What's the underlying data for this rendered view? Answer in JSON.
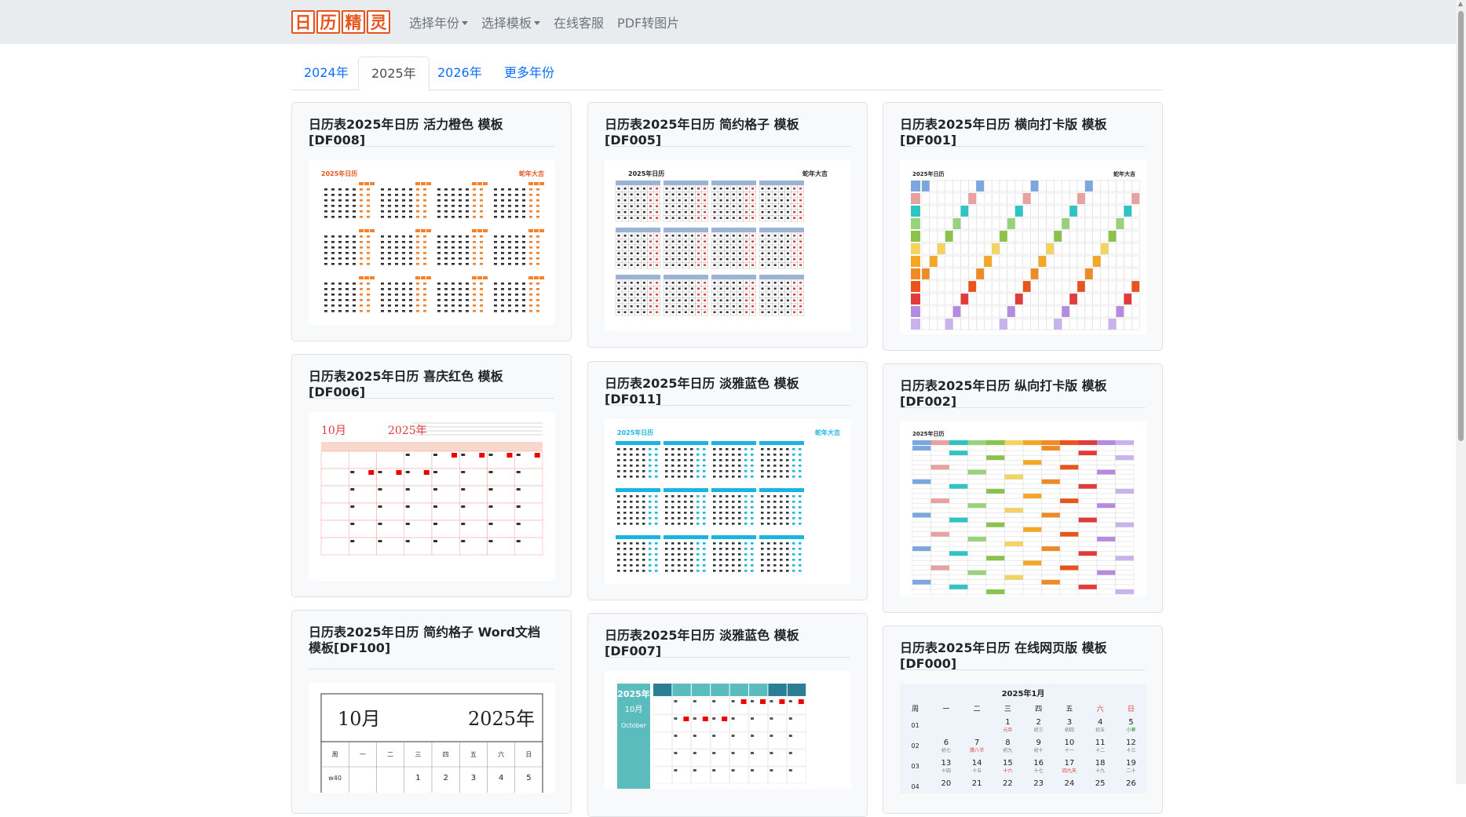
{
  "navbar": {
    "brand": [
      "日",
      "历",
      "精",
      "灵"
    ],
    "links": [
      "选择年份",
      "选择模板",
      "在线客服",
      "PDF转图片"
    ]
  },
  "tabs": [
    "2024年",
    "2025年",
    "2026年",
    "更多年份"
  ],
  "cards": [
    {
      "title": "日历表2025年日历 活力橙色 模板[DF008]",
      "heading": "2025年日历",
      "zodiac": "蛇年大吉"
    },
    {
      "title": "日历表2025年日历 简约格子 模板[DF005]",
      "heading": "2025年日历",
      "zodiac": "蛇年大吉"
    },
    {
      "title": "日历表2025年日历 横向打卡版 模板[DF001]",
      "heading": "2025年日历",
      "zodiac": "蛇年大吉"
    },
    {
      "title": "日历表2025年日历 喜庆红色 模板[DF006]",
      "month": "10月",
      "year": "2025年"
    },
    {
      "title": "日历表2025年日历 淡雅蓝色 模板[DF011]",
      "heading": "2025年日历",
      "zodiac": "蛇年大吉"
    },
    {
      "title": "日历表2025年日历 纵向打卡版 模板[DF002]",
      "heading": "2025年日历"
    },
    {
      "title": "日历表2025年日历 简约格子 Word文档 模板[DF100]",
      "month": "10月",
      "year": "2025年",
      "weekdays": [
        "周",
        "一",
        "二",
        "三",
        "四",
        "五",
        "六",
        "日"
      ],
      "week": "w40",
      "days": [
        "1",
        "2",
        "3",
        "4",
        "5"
      ]
    },
    {
      "title": "日历表2025年日历 淡雅蓝色 模板[DF007]",
      "year": "2025年",
      "month": "10月",
      "month_en": "October"
    },
    {
      "title": "日历表2025年日历 在线网页版 模板[DF000]",
      "heading": "2025年1月",
      "weekdays": [
        "周",
        "一",
        "二",
        "三",
        "四",
        "五",
        "六",
        "日"
      ],
      "rows": [
        {
          "week": "01",
          "days": [
            "",
            "",
            "1",
            "2",
            "3",
            "4",
            "5"
          ],
          "notes": [
            "",
            "",
            "元旦",
            "初三",
            "初四",
            "初五",
            "小寒"
          ]
        },
        {
          "week": "02",
          "days": [
            "6",
            "7",
            "8",
            "9",
            "10",
            "11",
            "12"
          ],
          "notes": [
            "初七",
            "腊八节",
            "初九",
            "初十",
            "十一",
            "十二",
            "十三"
          ]
        },
        {
          "week": "03",
          "days": [
            "13",
            "14",
            "15",
            "16",
            "17",
            "18",
            "19"
          ],
          "notes": [
            "十四",
            "十五",
            "十六",
            "十七",
            "四九天",
            "十九",
            "二十"
          ]
        },
        {
          "week": "04",
          "days": [
            "20",
            "21",
            "22",
            "23",
            "24",
            "25",
            "26"
          ],
          "notes": [
            "",
            "",
            "",
            "",
            "",
            "",
            ""
          ]
        }
      ]
    }
  ]
}
